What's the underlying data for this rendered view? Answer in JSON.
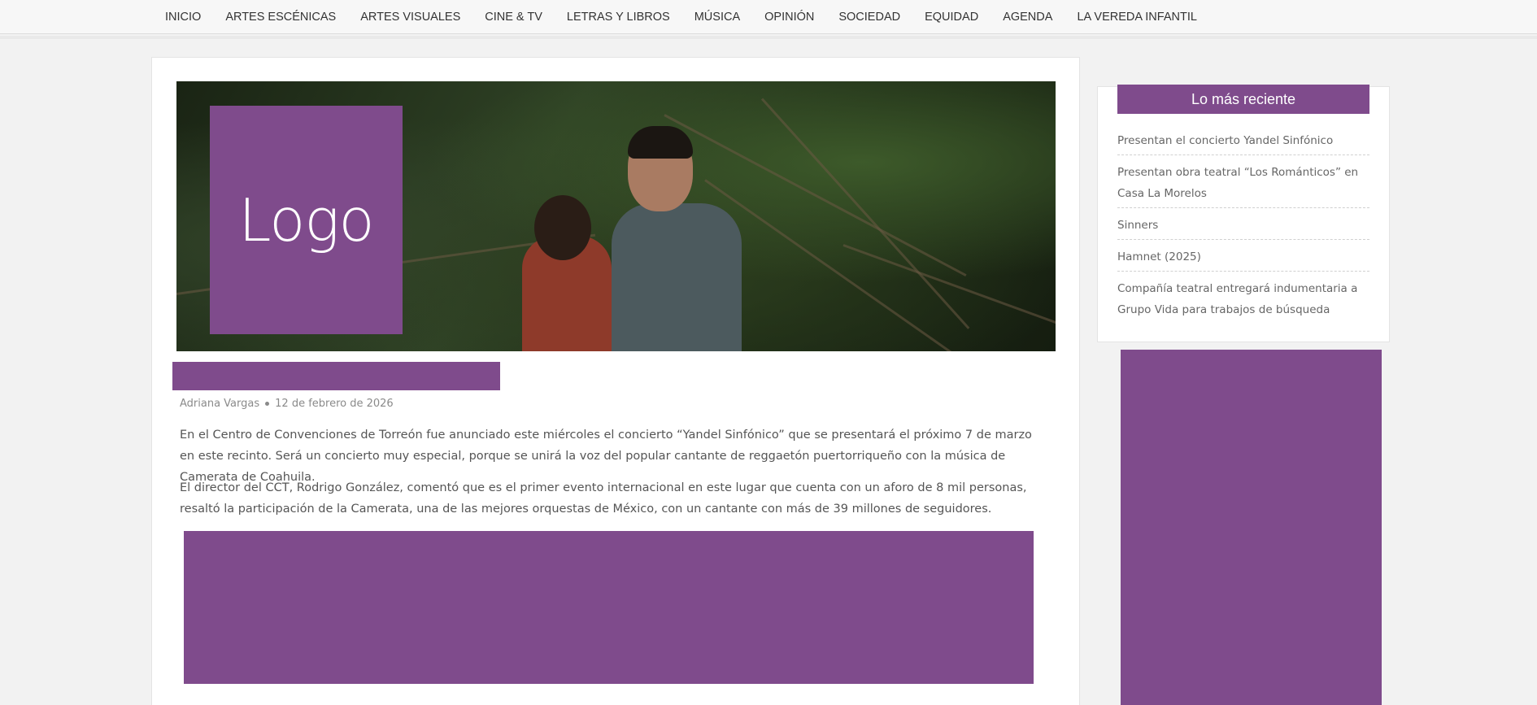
{
  "nav": {
    "items": [
      "INICIO",
      "ARTES ESCÉNICAS",
      "ARTES VISUALES",
      "CINE & TV",
      "LETRAS Y LIBROS",
      "MÚSICA",
      "OPINIÓN",
      "SOCIEDAD",
      "EQUIDAD",
      "AGENDA",
      "LA VEREDA INFANTIL"
    ]
  },
  "article": {
    "logo_text": "Logo",
    "author": "Adriana Vargas",
    "date": "12 de febrero de 2026",
    "paragraphs": [
      "En el Centro de Convenciones de Torreón fue anunciado este miércoles el concierto “Yandel Sinfónico” que se presentará el próximo 7 de marzo en este recinto. Será un concierto muy especial, porque se unirá la voz del popular cantante de reggaetón puertorriqueño con la música de Camerata de Coahuila.",
      "El director del CCT, Rodrigo González, comentó que es el primer evento internacional en este lugar que cuenta con un aforo de 8 mil personas, resaltó la participación de la Camerata, una de las mejores orquestas de México, con un cantante con más de 39 millones de seguidores."
    ]
  },
  "sidebar": {
    "widget_title": "Lo más reciente",
    "recent": [
      "Presentan el concierto Yandel Sinfónico",
      "Presentan obra teatral “Los Románticos” en Casa La Morelos",
      "Sinners",
      "Hamnet (2025)",
      "Compañía teatral entregará indumentaria a Grupo Vida para trabajos de búsqueda"
    ]
  },
  "colors": {
    "accent": "#7f4b8c",
    "page_bg": "#f2f2f2"
  }
}
